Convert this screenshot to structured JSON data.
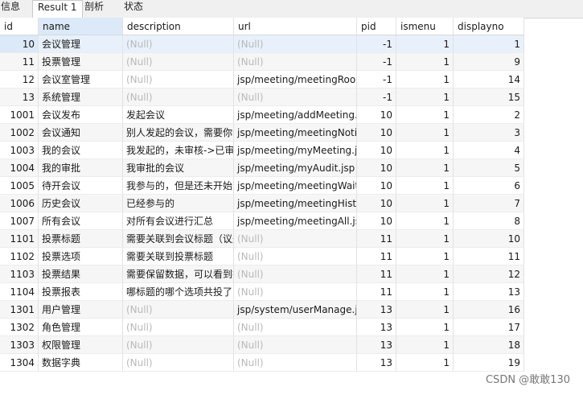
{
  "tabs": [
    "信息",
    "Result 1",
    "剖析",
    "状态"
  ],
  "active_tab": 1,
  "columns": [
    "id",
    "name",
    "description",
    "url",
    "pid",
    "ismenu",
    "displayno"
  ],
  "rows": [
    {
      "id": "10",
      "name": "会议管理",
      "description": "(Null)",
      "url": "(Null)",
      "pid": "-1",
      "ismenu": "1",
      "displayno": "1"
    },
    {
      "id": "11",
      "name": "投票管理",
      "description": "(Null)",
      "url": "(Null)",
      "pid": "-1",
      "ismenu": "1",
      "displayno": "9"
    },
    {
      "id": "12",
      "name": "会议室管理",
      "description": "(Null)",
      "url": "jsp/meeting/meetingRoom",
      "pid": "-1",
      "ismenu": "1",
      "displayno": "14"
    },
    {
      "id": "13",
      "name": "系统管理",
      "description": "(Null)",
      "url": "(Null)",
      "pid": "-1",
      "ismenu": "1",
      "displayno": "15"
    },
    {
      "id": "1001",
      "name": "会议发布",
      "description": "发起会议",
      "url": "jsp/meeting/addMeeting.",
      "pid": "10",
      "ismenu": "1",
      "displayno": "2"
    },
    {
      "id": "1002",
      "name": "会议通知",
      "description": "别人发起的会议，需要你参",
      "url": "jsp/meeting/meetingNotif",
      "pid": "10",
      "ismenu": "1",
      "displayno": "3"
    },
    {
      "id": "1003",
      "name": "我的会议",
      "description": "我发起的，未审核->已审核",
      "url": "jsp/meeting/myMeeting.js",
      "pid": "10",
      "ismenu": "1",
      "displayno": "4"
    },
    {
      "id": "1004",
      "name": "我的审批",
      "description": "我审批的会议",
      "url": "jsp/meeting/myAudit.jsp",
      "pid": "10",
      "ismenu": "1",
      "displayno": "5"
    },
    {
      "id": "1005",
      "name": "待开会议",
      "description": "我参与的，但是还未开始的",
      "url": "jsp/meeting/meetingWait",
      "pid": "10",
      "ismenu": "1",
      "displayno": "6"
    },
    {
      "id": "1006",
      "name": "历史会议",
      "description": "已经参与的",
      "url": "jsp/meeting/meetingHisto",
      "pid": "10",
      "ismenu": "1",
      "displayno": "7"
    },
    {
      "id": "1007",
      "name": "所有会议",
      "description": "对所有会议进行汇总",
      "url": "jsp/meeting/meetingAll.js",
      "pid": "10",
      "ismenu": "1",
      "displayno": "8"
    },
    {
      "id": "1101",
      "name": "投票标题",
      "description": "需要关联到会议标题（议题",
      "url": "(Null)",
      "pid": "11",
      "ismenu": "1",
      "displayno": "10"
    },
    {
      "id": "1102",
      "name": "投票选项",
      "description": "需要关联到投票标题",
      "url": "(Null)",
      "pid": "11",
      "ismenu": "1",
      "displayno": "11"
    },
    {
      "id": "1103",
      "name": "投票结果",
      "description": "需要保留数据，可以看到投",
      "url": "(Null)",
      "pid": "11",
      "ismenu": "1",
      "displayno": "12"
    },
    {
      "id": "1104",
      "name": "投票报表",
      "description": "哪标题的哪个选项共投了多",
      "url": "(Null)",
      "pid": "11",
      "ismenu": "1",
      "displayno": "13"
    },
    {
      "id": "1301",
      "name": "用户管理",
      "description": "(Null)",
      "url": "jsp/system/userManage.js",
      "pid": "13",
      "ismenu": "1",
      "displayno": "16"
    },
    {
      "id": "1302",
      "name": "角色管理",
      "description": "(Null)",
      "url": "(Null)",
      "pid": "13",
      "ismenu": "1",
      "displayno": "17"
    },
    {
      "id": "1303",
      "name": "权限管理",
      "description": "(Null)",
      "url": "(Null)",
      "pid": "13",
      "ismenu": "1",
      "displayno": "18"
    },
    {
      "id": "1304",
      "name": "数据字典",
      "description": "(Null)",
      "url": "(Null)",
      "pid": "13",
      "ismenu": "1",
      "displayno": "19"
    }
  ],
  "watermark": "CSDN @敢敢130"
}
